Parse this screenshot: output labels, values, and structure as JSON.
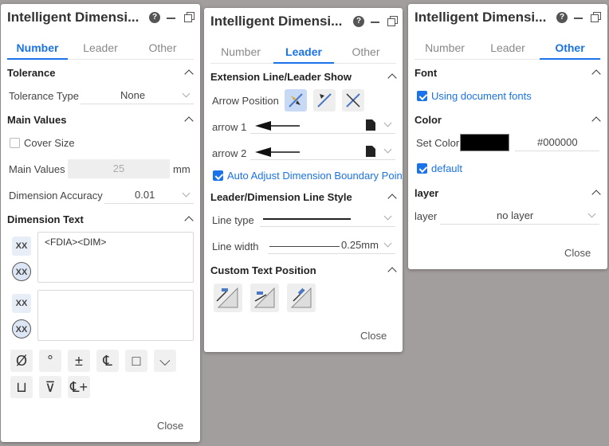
{
  "panels": [
    {
      "title": "Intelligent Dimensi...",
      "tabs": [
        {
          "label": "Number"
        },
        {
          "label": "Leader"
        },
        {
          "label": "Other"
        }
      ],
      "active_tab": "Number",
      "tolerance": {
        "section": "Tolerance",
        "type_label": "Tolerance Type",
        "type_value": "None"
      },
      "main_values": {
        "section": "Main Values",
        "cover_size_label": "Cover Size",
        "value_label": "Main Values",
        "value": "25",
        "unit": "mm",
        "accuracy_label": "Dimension Accuracy",
        "accuracy_value": "0.01"
      },
      "dimension_text": {
        "section": "Dimension Text",
        "text1": "<FDIA><DIM>",
        "text2": "",
        "xx_label": "XX",
        "symbols": [
          "Ø",
          "°",
          "±",
          "℄",
          "□",
          "⌵",
          "⊔",
          "⊽",
          "℄+"
        ]
      },
      "close_label": "Close"
    },
    {
      "title": "Intelligent Dimensi...",
      "tabs": [
        {
          "label": "Number"
        },
        {
          "label": "Leader"
        },
        {
          "label": "Other"
        }
      ],
      "active_tab": "Leader",
      "extension": {
        "section": "Extension Line/Leader Show",
        "arrow_position_label": "Arrow Position",
        "arrow1_label": "arrow 1",
        "arrow2_label": "arrow 2",
        "auto_adjust_label": "Auto Adjust Dimension Boundary Point"
      },
      "line_style": {
        "section": "Leader/Dimension Line Style",
        "line_type_label": "Line type",
        "line_width_label": "Line width",
        "line_width_value": "0.25mm"
      },
      "custom_text": {
        "section": "Custom Text Position"
      },
      "close_label": "Close"
    },
    {
      "title": "Intelligent Dimensi...",
      "tabs": [
        {
          "label": "Number"
        },
        {
          "label": "Leader"
        },
        {
          "label": "Other"
        }
      ],
      "active_tab": "Other",
      "font": {
        "section": "Font",
        "use_doc_fonts_label": "Using document fonts"
      },
      "color": {
        "section": "Color",
        "set_color_label": "Set Color",
        "hex": "#000000",
        "default_label": "default"
      },
      "layer": {
        "section": "layer",
        "label": "layer",
        "value": "no layer"
      },
      "close_label": "Close"
    }
  ],
  "colors": {
    "accent": "#1a73e8",
    "swatch": "#000000"
  }
}
